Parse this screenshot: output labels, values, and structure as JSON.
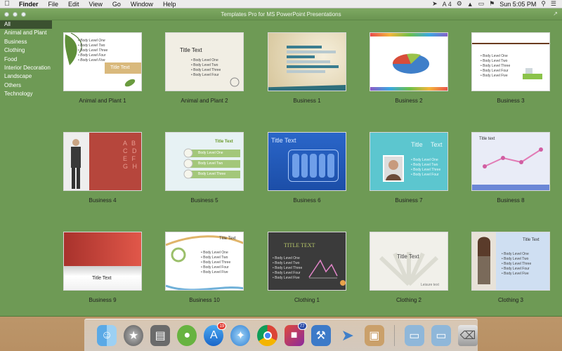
{
  "menubar": {
    "app": "Finder",
    "items": [
      "File",
      "Edit",
      "View",
      "Go",
      "Window",
      "Help"
    ],
    "clock": "Sun 5:05 PM",
    "status_icons": [
      "location-icon",
      "adobe-icon",
      "wifi-icon",
      "battery-icon",
      "flag-icon",
      "search-icon",
      "list-icon"
    ],
    "adobe_count": "4"
  },
  "window": {
    "title": "Templates Pro for MS PowerPoint Presentations"
  },
  "sidebar": {
    "categories": [
      "All",
      "Animal and Plant",
      "Business",
      "Clothing",
      "Food",
      "Interior Decoration",
      "Landscape",
      "Others",
      "Technology"
    ],
    "selected": "All"
  },
  "thumb_text": {
    "title": "Title Text",
    "title_caps": "TITLE TEXT",
    "title_lower": "Title text",
    "title_split_a": "Title",
    "title_split_b": "Text",
    "leisure": "Leisure text",
    "b1": "Body Level One",
    "b2": "Body Level Two",
    "b3": "Body Level Three",
    "b4": "Body Level Four",
    "b5": "Body Level Five"
  },
  "templates": [
    "Animal and Plant 1",
    "Animal and Plant 2",
    "Business 1",
    "Business 2",
    "Business 3",
    "Business 4",
    "Business 5",
    "Business 6",
    "Business 7",
    "Business 8",
    "Business 9",
    "Business 10",
    "Clothing 1",
    "Clothing 2",
    "Clothing 3"
  ],
  "dock": {
    "items": [
      "finder-icon",
      "launchpad-icon",
      "dashboard-icon",
      "frog-app-icon",
      "app-store-icon",
      "safari-icon",
      "chrome-icon",
      "cube-app-icon",
      "xcode-icon",
      "paper-plane-icon",
      "box-icon",
      "folder-icon",
      "folder-icon",
      "trash-icon"
    ],
    "app_store_badge": "19",
    "cube_badge": "77"
  },
  "colors": {
    "window_bg": "#6e9a55",
    "sidebar_selected": "#3b5130"
  }
}
